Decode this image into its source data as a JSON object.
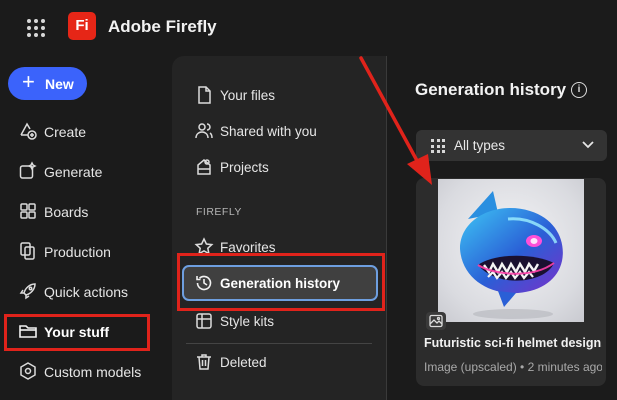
{
  "app": {
    "title": "Adobe Firefly",
    "logo_text": "Fi"
  },
  "left_nav": {
    "new_label": "New",
    "items": [
      {
        "label": "Create",
        "icon": "create-icon"
      },
      {
        "label": "Generate",
        "icon": "generate-icon"
      },
      {
        "label": "Boards",
        "icon": "boards-icon"
      },
      {
        "label": "Production",
        "icon": "production-icon"
      },
      {
        "label": "Quick actions",
        "icon": "rocket-icon"
      },
      {
        "label": "Your stuff",
        "icon": "folder-icon",
        "active": true
      },
      {
        "label": "Custom models",
        "icon": "custom-models-icon"
      }
    ]
  },
  "middle": {
    "items": [
      {
        "label": "Your files",
        "icon": "file-icon"
      },
      {
        "label": "Shared with you",
        "icon": "shared-icon"
      },
      {
        "label": "Projects",
        "icon": "projects-icon"
      }
    ],
    "section_label": "FIREFLY",
    "firefly_items": [
      {
        "label": "Favorites",
        "icon": "star-icon"
      },
      {
        "label": "Generation history",
        "icon": "history-icon",
        "selected": true
      },
      {
        "label": "Style kits",
        "icon": "style-kits-icon"
      }
    ],
    "deleted_label": "Deleted"
  },
  "right": {
    "title": "Generation history",
    "info_glyph": "i",
    "filter_value": "All types",
    "card": {
      "title": "Futuristic sci-fi helmet design...",
      "meta": "Image (upscaled) • 2 minutes ago"
    }
  },
  "colors": {
    "background": "#1b1b1b",
    "panel": "#242424",
    "accent_blue": "#3b63fb",
    "brand_red": "#e62617",
    "annotation_red": "#e0231b",
    "selected_border": "#6e9fe0"
  }
}
